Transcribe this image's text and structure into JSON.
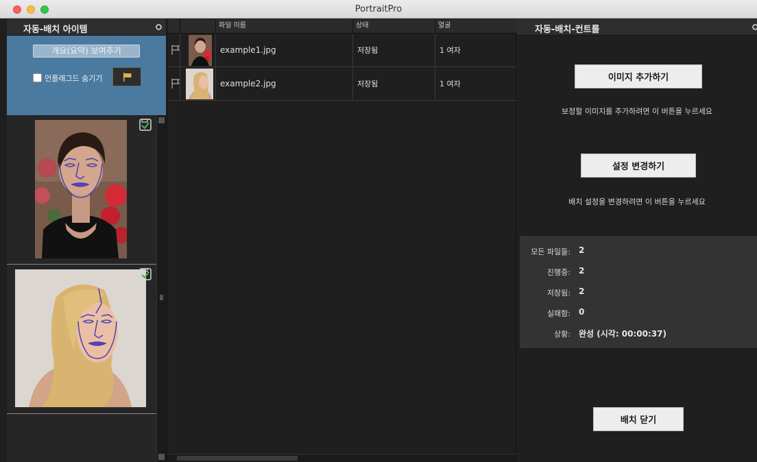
{
  "window": {
    "title": "PortraitPro"
  },
  "left_panel": {
    "title": "자동-배치 아이템",
    "overview_label": "개요(요약) 보여주기",
    "hide_unflagged_label": "언플래그드 숨기기"
  },
  "table": {
    "columns": [
      "파일 이름",
      "상태",
      "얼굴"
    ],
    "rows": [
      {
        "filename": "example1.jpg",
        "status": "저장됨",
        "faces": "1 여자"
      },
      {
        "filename": "example2.jpg",
        "status": "저장됨",
        "faces": "1 여자"
      }
    ]
  },
  "right_panel": {
    "title": "자동-배치-컨트롤",
    "add_images_label": "이미지 추가하기",
    "add_images_hint": "보정할 이미지를 추가하려면 이 버튼을 누르세요",
    "change_settings_label": "설정 변경하기",
    "change_settings_hint": "배치 설정을 변경하려면 이 버튼을 누르세요",
    "stats": [
      {
        "label": "모든 파일들:",
        "value": "2"
      },
      {
        "label": "진행중:",
        "value": "2"
      },
      {
        "label": "저장됨:",
        "value": "2"
      },
      {
        "label": "실패함:",
        "value": "0"
      },
      {
        "label": "상황:",
        "value": "완성 (시각: 00:00:37)"
      }
    ],
    "close_batch_label": "배치 닫기"
  },
  "colors": {
    "panel_blue": "#4b7aa0",
    "face_outline": "#4a3fb0",
    "check_green": "#3fb84a"
  }
}
